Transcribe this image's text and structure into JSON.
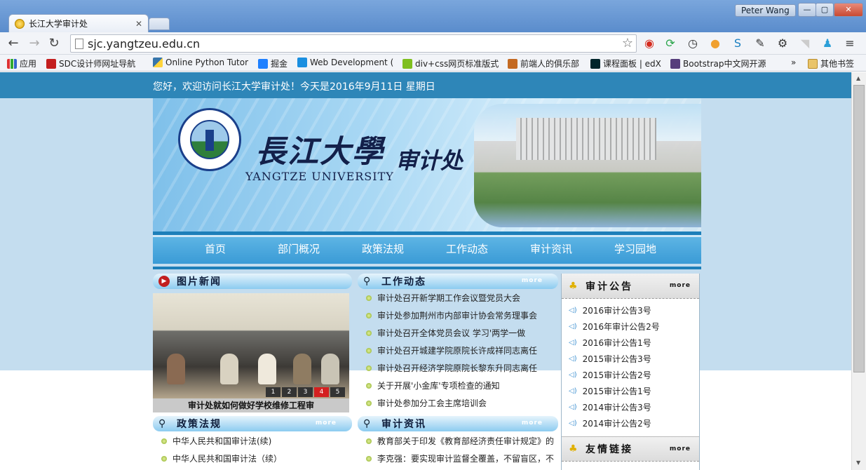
{
  "window": {
    "tab_title": "长江大学审计处",
    "tab_close": "✕",
    "user_name": "Peter Wang",
    "min_label": "—",
    "max_label": "▢",
    "close_label": "✕"
  },
  "toolbar": {
    "back": "←",
    "forward": "→",
    "reload": "↻",
    "url": "sjc.yangtzeu.edu.cn",
    "star": "☆",
    "menu": "≡",
    "extension_icons": [
      "weibo-icon",
      "sync-icon",
      "clock-icon",
      "pin-icon",
      "s-icon",
      "pen-icon",
      "gear-icon",
      "rss-icon",
      "user-icon"
    ]
  },
  "bookmarks": {
    "apps_label": "应用",
    "items": [
      "SDC设计师网址导航",
      "Online Python Tutor",
      "掘金",
      "Web Development (",
      "div+css网页标准版式",
      "前端人的俱乐部",
      "课程面板 | edX",
      "Bootstrap中文网开源"
    ],
    "overflow": "»",
    "other_label": "其他书签"
  },
  "site": {
    "welcome": "您好，欢迎访问长江大学审计处！今天是2016年9月11日   星期日",
    "brand_cn": "長江大學",
    "brand_en": "YANGTZE UNIVERSITY",
    "dept": "审计处",
    "nav": [
      "首页",
      "部门概况",
      "政策法规",
      "工作动态",
      "审计资讯",
      "学习园地"
    ]
  },
  "sections": {
    "photo_news": {
      "title": "图片新闻",
      "caption": "审计处就如何做好学校维修工程审",
      "pager": [
        "1",
        "2",
        "3",
        "4",
        "5"
      ],
      "active_page": "4"
    },
    "work": {
      "title": "工作动态",
      "more": "more",
      "items": [
        "审计处召开新学期工作会议暨党员大会",
        "审计处参加荆州市内部审计协会常务理事会",
        "审计处召开全体党员会议 学习'两学一做",
        "审计处召开城建学院原院长许成祥同志离任",
        "审计处召开经济学院原院长黎东升同志离任",
        "关于开展'小金库'专项检查的通知",
        "审计处参加分工会主席培训会"
      ]
    },
    "policy": {
      "title": "政策法规",
      "more": "more",
      "items": [
        "中华人民共和国审计法(续)",
        "中华人民共和国审计法（续）"
      ]
    },
    "info": {
      "title": "审计资讯",
      "more": "more",
      "items": [
        "教育部关于印发《教育部经济责任审计规定》的",
        "李克强：要实现审计监督全覆盖，不留盲区，不"
      ]
    },
    "notices": {
      "title": "审计公告",
      "more": "more",
      "items": [
        "2016审计公告3号",
        "2016年审计公告2号",
        "2016审计公告1号",
        "2015审计公告3号",
        "2015审计公告2号",
        "2015审计公告1号",
        "2014审计公告3号",
        "2014审计公告2号"
      ]
    },
    "links": {
      "title": "友情链接",
      "more": "more"
    }
  },
  "colors": {
    "topbar": "#2e86b8",
    "page_band": "#c4ddef",
    "nav": "#3a9bd6",
    "active_page": "#d42020"
  }
}
